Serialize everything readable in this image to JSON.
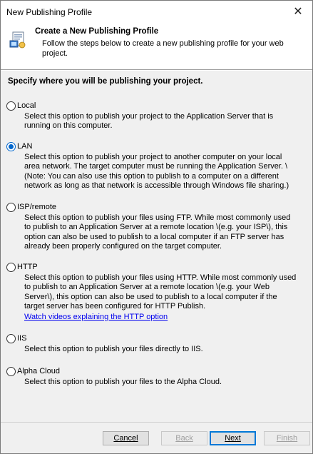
{
  "window": {
    "title": "New Publishing Profile",
    "close_symbol": "✕"
  },
  "header": {
    "title": "Create a New Publishing Profile",
    "subtitle": "Follow the steps below to create a new publishing profile for your web project.",
    "icon": "publishing-profile-icon"
  },
  "instruction": "Specify where you will be publishing your project.",
  "options": [
    {
      "label": "Local",
      "selected": false,
      "description": "Select this option to publish your project to the Application Server that is running on this computer."
    },
    {
      "label": "LAN",
      "selected": true,
      "description": "Select this option to publish your project to another computer on your local area network.  The target computer must be running the Application Server. \\(Note: You can also use this option to publish to a computer on a different network as long as that network is accessible through Windows file sharing.)"
    },
    {
      "label": "ISP/remote",
      "selected": false,
      "description": "Select this option to publish your files using FTP. While most commonly used to publish to an Application Server at a remote location \\(e.g. your ISP\\), this option can also be used to publish to a local computer if an FTP server has already been properly configured on the target computer."
    },
    {
      "label": "HTTP",
      "selected": false,
      "description": "Select this option to publish your files using HTTP. While most commonly used to publish to an Application Server at a remote location \\(e.g. your Web Server\\), this option can also be used to publish to a local computer if the target server has been configured for HTTP Publish.",
      "link": "Watch videos explaining the HTTP option"
    },
    {
      "label": "IIS",
      "selected": false,
      "description": "Select this option to publish your files directly to IIS."
    },
    {
      "label": "Alpha Cloud",
      "selected": false,
      "description": "Select this option to publish your files to the Alpha Cloud."
    }
  ],
  "buttons": {
    "cancel": {
      "label": "Cancel",
      "enabled": true
    },
    "back": {
      "label": "Back",
      "enabled": false
    },
    "next": {
      "label": "Next",
      "enabled": true
    },
    "finish": {
      "label": "Finish",
      "enabled": false
    }
  },
  "colors": {
    "accent": "#0066cc",
    "link": "#0000ee",
    "dialog_bg": "#f0f0f0"
  }
}
